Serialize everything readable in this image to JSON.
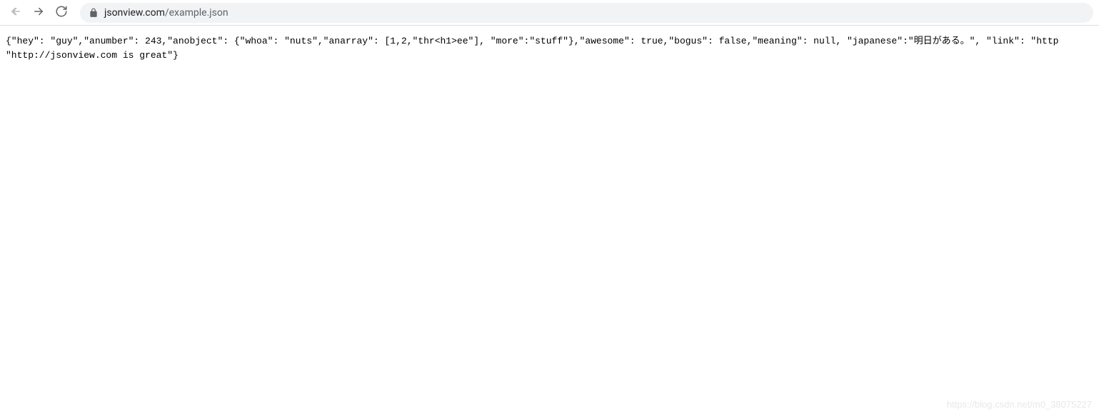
{
  "toolbar": {
    "url_domain": "jsonview.com",
    "url_path": "/example.json"
  },
  "content": {
    "line1": "{\"hey\": \"guy\",\"anumber\": 243,\"anobject\": {\"whoa\": \"nuts\",\"anarray\": [1,2,\"thr<h1>ee\"], \"more\":\"stuff\"},\"awesome\": true,\"bogus\": false,\"meaning\": null, \"japanese\":\"明日がある。\", \"link\": \"http",
    "line2": "\"http://jsonview.com is great\"}"
  },
  "watermark": "https://blog.csdn.net/m0_38075227"
}
